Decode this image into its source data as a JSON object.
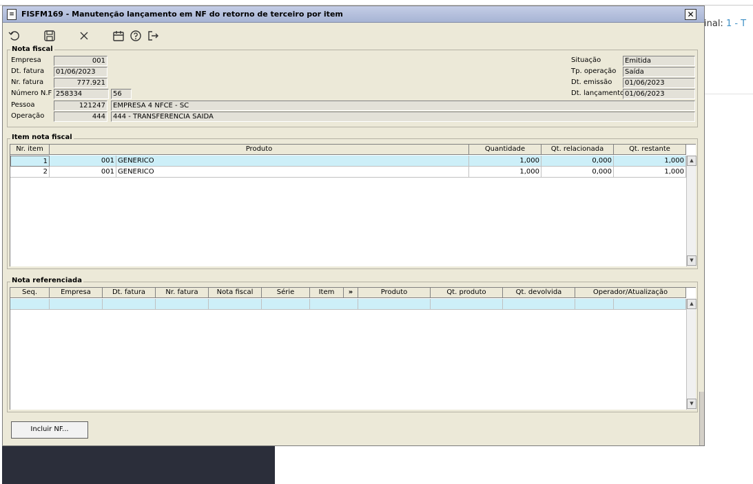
{
  "background": {
    "right_text_prefix": "inal: ",
    "right_text_accent": "1 - T"
  },
  "window": {
    "title": "FISFM169 - Manutenção lançamento em NF do retorno de terceiro por item",
    "close_glyph": "✕",
    "toolbar": [
      {
        "icon": "undo-icon"
      },
      {
        "icon": "save-icon"
      },
      {
        "icon": "cancel-icon"
      },
      {
        "icon": "calendar-icon"
      },
      {
        "icon": "help-icon"
      },
      {
        "icon": "exit-icon"
      }
    ]
  },
  "nota_fiscal": {
    "title": "Nota fiscal",
    "empresa_label": "Empresa",
    "empresa": "001",
    "dt_fatura_label": "Dt. fatura",
    "dt_fatura": "01/06/2023",
    "nr_fatura_label": "Nr. fatura",
    "nr_fatura": "777.921",
    "numero_nf_label": "Número N.F",
    "numero_nf": "258334",
    "serie": "56",
    "pessoa_label": "Pessoa",
    "pessoa_code": "121247",
    "pessoa_name": "EMPRESA 4 NFCE - SC",
    "operacao_label": "Operação",
    "operacao_code": "444",
    "operacao_name": "444 - TRANSFERENCIA SAIDA",
    "situacao_label": "Situação",
    "situacao": "Emitida",
    "tp_operacao_label": "Tp. operação",
    "tp_operacao": "Saída",
    "dt_emissao_label": "Dt. emissão",
    "dt_emissao": "01/06/2023",
    "dt_lancamento_label": "Dt. lançamento",
    "dt_lancamento": "01/06/2023"
  },
  "item_nota": {
    "title": "Item nota fiscal",
    "columns": [
      "Nr. item",
      "Produto",
      "Quantidade",
      "Qt. relacionada",
      "Qt. restante"
    ],
    "rows": [
      {
        "nr": "1",
        "codigo": "001",
        "produto": "GENERICO",
        "quantidade": "1,000",
        "qt_relacionada": "0,000",
        "qt_restante": "1,000"
      },
      {
        "nr": "2",
        "codigo": "001",
        "produto": "GENERICO",
        "quantidade": "1,000",
        "qt_relacionada": "0,000",
        "qt_restante": "1,000"
      }
    ]
  },
  "nota_ref": {
    "title": "Nota referenciada",
    "columns": [
      "Seq.",
      "Empresa",
      "Dt. fatura",
      "Nr. fatura",
      "Nota fiscal",
      "Série",
      "Item",
      "»",
      "Produto",
      "Qt. produto",
      "Qt. devolvida",
      "Operador/Atualização"
    ]
  },
  "buttons": {
    "incluir_nf": "Incluir NF..."
  },
  "scroll": {
    "up": "▲",
    "down": "▼"
  }
}
